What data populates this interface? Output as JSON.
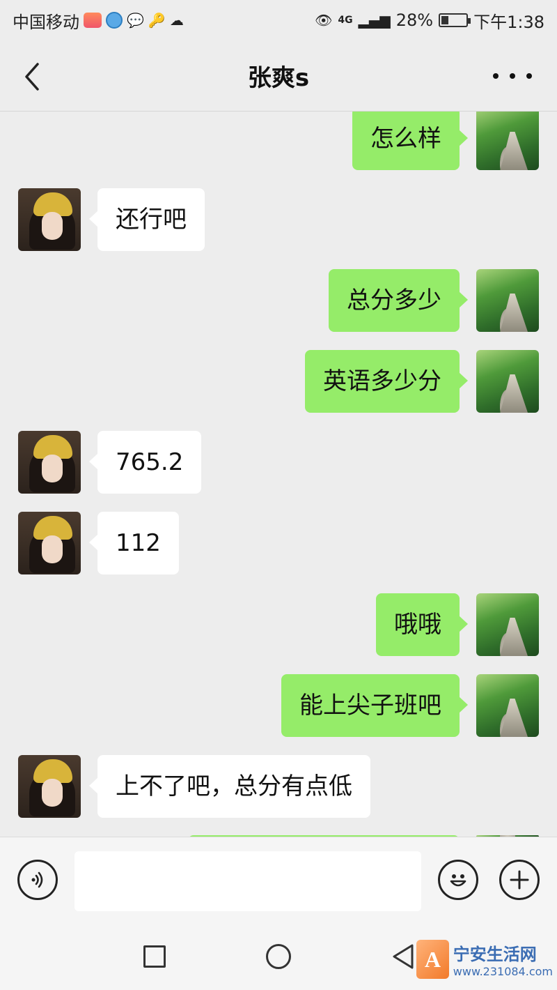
{
  "status_bar": {
    "carrier": "中国移动",
    "network": "4G",
    "battery": "28%",
    "time": "下午1:38"
  },
  "header": {
    "title": "张爽s"
  },
  "messages": [
    {
      "sender": "me",
      "text": "怎么样"
    },
    {
      "sender": "them",
      "text": "还行吧"
    },
    {
      "sender": "me",
      "text": "总分多少"
    },
    {
      "sender": "me",
      "text": "英语多少分"
    },
    {
      "sender": "them",
      "text": "765.2"
    },
    {
      "sender": "them",
      "text": "112"
    },
    {
      "sender": "me",
      "text": "哦哦"
    },
    {
      "sender": "me",
      "text": "能上尖子班吧"
    },
    {
      "sender": "them",
      "text": "上不了吧，总分有点低"
    }
  ],
  "input_bar": {
    "placeholder": ""
  },
  "watermark": {
    "logo_letter": "A",
    "name": "宁安生活网",
    "url": "www.231084.com"
  }
}
